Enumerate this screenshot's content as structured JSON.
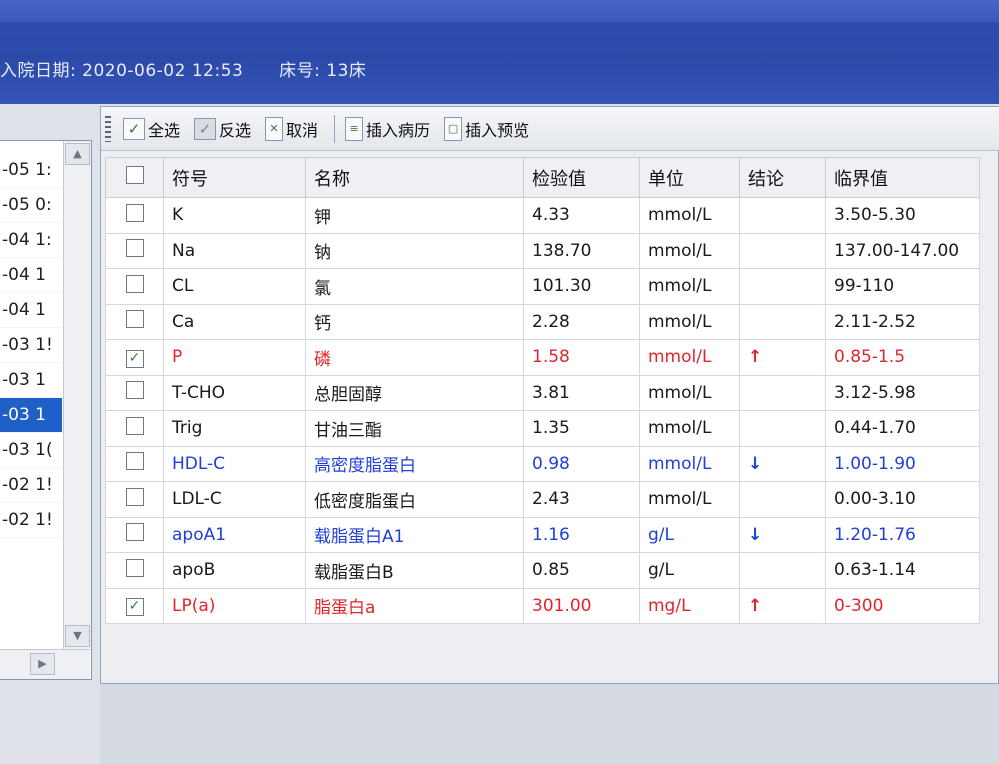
{
  "header": {
    "admit_date_label": "入院日期:",
    "admit_date_value": "2020-06-02 12:53",
    "bed_label": "床号:",
    "bed_value": "13床"
  },
  "left_list": {
    "items": [
      {
        "text": "-05 1:",
        "selected": false
      },
      {
        "text": "-05 0:",
        "selected": false
      },
      {
        "text": "-04 1:",
        "selected": false
      },
      {
        "text": "-04 1",
        "selected": false
      },
      {
        "text": "-04 1",
        "selected": false
      },
      {
        "text": "-03 1!",
        "selected": false
      },
      {
        "text": "-03 1",
        "selected": false
      },
      {
        "text": "-03 1",
        "selected": true
      },
      {
        "text": "-03 1(",
        "selected": false
      },
      {
        "text": "-02 1!",
        "selected": false
      },
      {
        "text": "-02 1!",
        "selected": false
      }
    ],
    "scroll_up_icon": "chevron-up-icon",
    "scroll_down_icon": "chevron-down-icon",
    "scroll_right_icon": "chevron-right-icon"
  },
  "toolbar": {
    "select_all": "全选",
    "invert": "反选",
    "cancel": "取消",
    "insert_record": "插入病历",
    "insert_preview": "插入预览"
  },
  "table": {
    "columns": [
      "符号",
      "名称",
      "检验值",
      "单位",
      "结论",
      "临界值"
    ],
    "rows": [
      {
        "checked": false,
        "status": "normal",
        "symbol": "K",
        "name": "钾",
        "value": "4.33",
        "unit": "mmol/L",
        "flag": "",
        "range": "3.50-5.30"
      },
      {
        "checked": false,
        "status": "normal",
        "symbol": "Na",
        "name": "钠",
        "value": "138.70",
        "unit": "mmol/L",
        "flag": "",
        "range": "137.00-147.00"
      },
      {
        "checked": false,
        "status": "normal",
        "symbol": "CL",
        "name": "氯",
        "value": "101.30",
        "unit": "mmol/L",
        "flag": "",
        "range": "99-110"
      },
      {
        "checked": false,
        "status": "normal",
        "symbol": "Ca",
        "name": "钙",
        "value": "2.28",
        "unit": "mmol/L",
        "flag": "",
        "range": "2.11-2.52"
      },
      {
        "checked": true,
        "status": "high",
        "symbol": "P",
        "name": "磷",
        "value": "1.58",
        "unit": "mmol/L",
        "flag": "↑",
        "range": "0.85-1.5"
      },
      {
        "checked": false,
        "status": "normal",
        "symbol": "T-CHO",
        "name": "总胆固醇",
        "value": "3.81",
        "unit": "mmol/L",
        "flag": "",
        "range": "3.12-5.98"
      },
      {
        "checked": false,
        "status": "normal",
        "symbol": "Trig",
        "name": "甘油三酯",
        "value": "1.35",
        "unit": "mmol/L",
        "flag": "",
        "range": "0.44-1.70"
      },
      {
        "checked": false,
        "status": "low",
        "symbol": "HDL-C",
        "name": "高密度脂蛋白",
        "value": "0.98",
        "unit": "mmol/L",
        "flag": "↓",
        "range": "1.00-1.90"
      },
      {
        "checked": false,
        "status": "normal",
        "symbol": "LDL-C",
        "name": "低密度脂蛋白",
        "value": "2.43",
        "unit": "mmol/L",
        "flag": "",
        "range": "0.00-3.10"
      },
      {
        "checked": false,
        "status": "low",
        "symbol": "apoA1",
        "name": "载脂蛋白A1",
        "value": "1.16",
        "unit": "g/L",
        "flag": "↓",
        "range": "1.20-1.76"
      },
      {
        "checked": false,
        "status": "normal",
        "symbol": "apoB",
        "name": "载脂蛋白B",
        "value": "0.85",
        "unit": "g/L",
        "flag": "",
        "range": "0.63-1.14"
      },
      {
        "checked": true,
        "status": "high",
        "symbol": "LP(a)",
        "name": "脂蛋白a",
        "value": "301.00",
        "unit": "mg/L",
        "flag": "↑",
        "range": "0-300"
      }
    ]
  },
  "colors": {
    "high": "#e0262b",
    "low": "#1f3fd6",
    "selected_row": "#1e5fc8",
    "header_band": "#2f4fb2"
  }
}
